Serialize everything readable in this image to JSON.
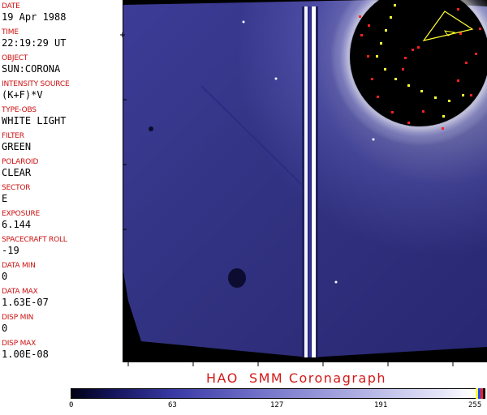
{
  "metadata": [
    {
      "label": "DATE",
      "value": "19 Apr 1988"
    },
    {
      "label": "TIME",
      "value": "22:19:29 UT"
    },
    {
      "label": "OBJECT",
      "value": "SUN:CORONA"
    },
    {
      "label": "INTENSITY SOURCE",
      "value": "(K+F)*V"
    },
    {
      "label": "TYPE-OBS",
      "value": "WHITE LIGHT"
    },
    {
      "label": "FILTER",
      "value": "GREEN"
    },
    {
      "label": "POLAROID",
      "value": "CLEAR"
    },
    {
      "label": "SECTOR",
      "value": "E"
    },
    {
      "label": "EXPOSURE",
      "value": "6.144"
    },
    {
      "label": "SPACECRAFT ROLL",
      "value": "-19"
    },
    {
      "label": "DATA MIN",
      "value": "0"
    },
    {
      "label": "DATA MAX",
      "value": "1.63E-07"
    },
    {
      "label": "DISP MIN",
      "value": "0"
    },
    {
      "label": "DISP MAX",
      "value": "1.00E-08"
    }
  ],
  "title": "HAO  SMM Coronagraph",
  "colorbar": {
    "ticks": [
      "0",
      "63",
      "127",
      "191",
      "255"
    ]
  },
  "colors": {
    "label": "#cc1010",
    "title": "#d11a1a",
    "corona": "#5050b8",
    "occulter_marks_red": "#ff2020",
    "occulter_marks_yellow": "#ffff30"
  }
}
